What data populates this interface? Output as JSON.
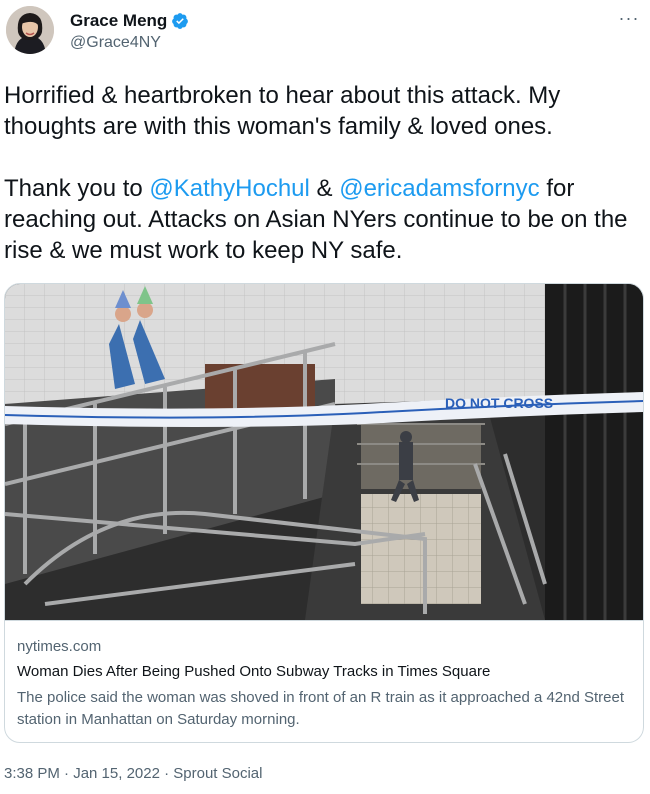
{
  "author": {
    "display_name": "Grace Meng",
    "handle": "@Grace4NY",
    "verified": true
  },
  "menu": {
    "more_label": "···"
  },
  "tweet": {
    "line1": "Horrified & heartbroken to hear about this attack. My thoughts are with this woman's family & loved ones.",
    "line2_prefix": "Thank you to ",
    "mention1": "@KathyHochul",
    "line2_mid": " & ",
    "mention2": "@ericadamsfornyc",
    "line2_suffix": " for reaching out. Attacks on Asian NYers continue to be on the rise & we must work to keep NY safe."
  },
  "card": {
    "domain": "nytimes.com",
    "title": "Woman Dies After Being Pushed Onto Subway Tracks in Times Square",
    "description": "The police said the woman was shoved in front of an R train as it approached a 42nd Street station in Manhattan on Saturday morning.",
    "tape_text": "DO NOT CROSS"
  },
  "meta": {
    "timestamp": "3:38 PM · Jan 15, 2022 · Sprout Social"
  },
  "colors": {
    "mention": "#1d9bf0",
    "verified_badge": "#1d9bf0",
    "secondary_text": "#536471",
    "border": "#cfd9de"
  }
}
